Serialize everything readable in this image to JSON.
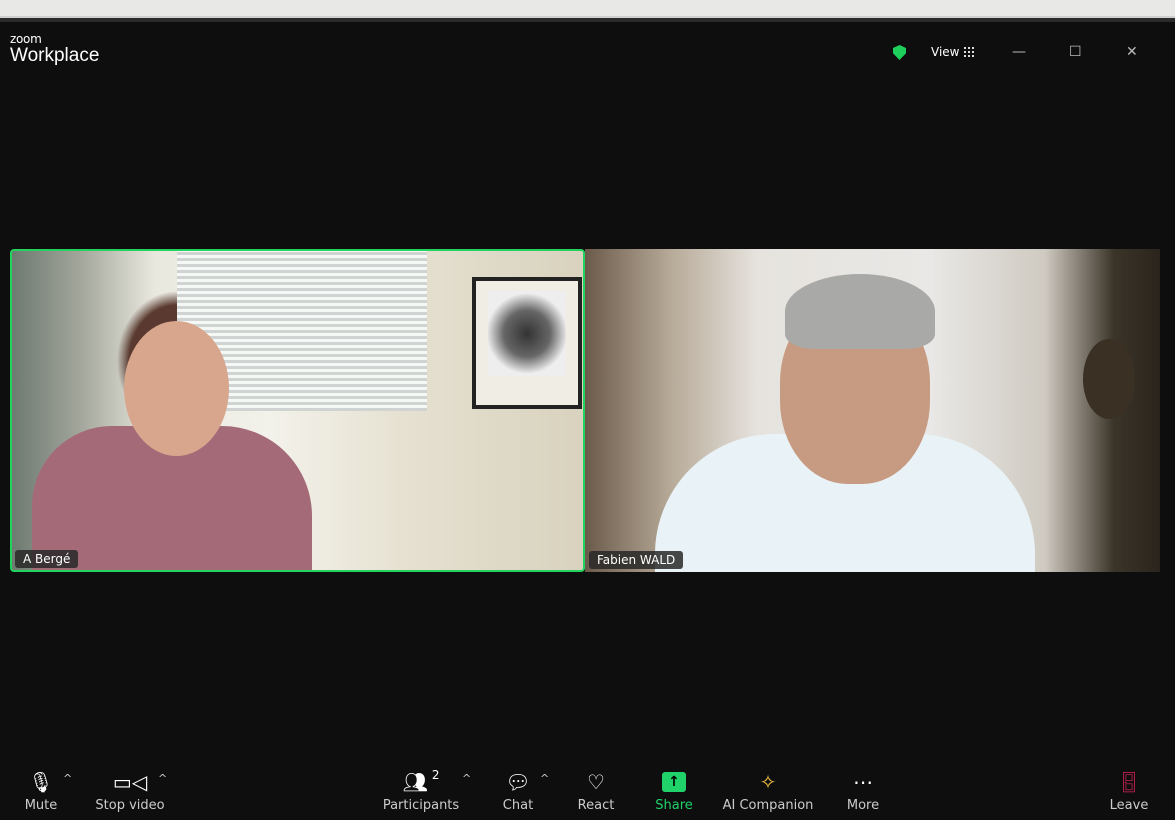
{
  "app": {
    "logo_small": "zoom",
    "logo_big": "Workplace",
    "view_label": "View"
  },
  "participants": [
    {
      "name": "A Bergé",
      "active_speaker": true
    },
    {
      "name": "Fabien WALD",
      "active_speaker": false
    }
  ],
  "toolbar": {
    "mute": "Mute",
    "stop_video": "Stop video",
    "participants": "Participants",
    "participants_count": "2",
    "chat": "Chat",
    "react": "React",
    "share": "Share",
    "ai_companion": "AI Companion",
    "more": "More",
    "leave": "Leave"
  },
  "colors": {
    "accent": "#22d35e",
    "share": "#1fd36a",
    "ai": "#f5c542",
    "leave": "#e0245e"
  }
}
